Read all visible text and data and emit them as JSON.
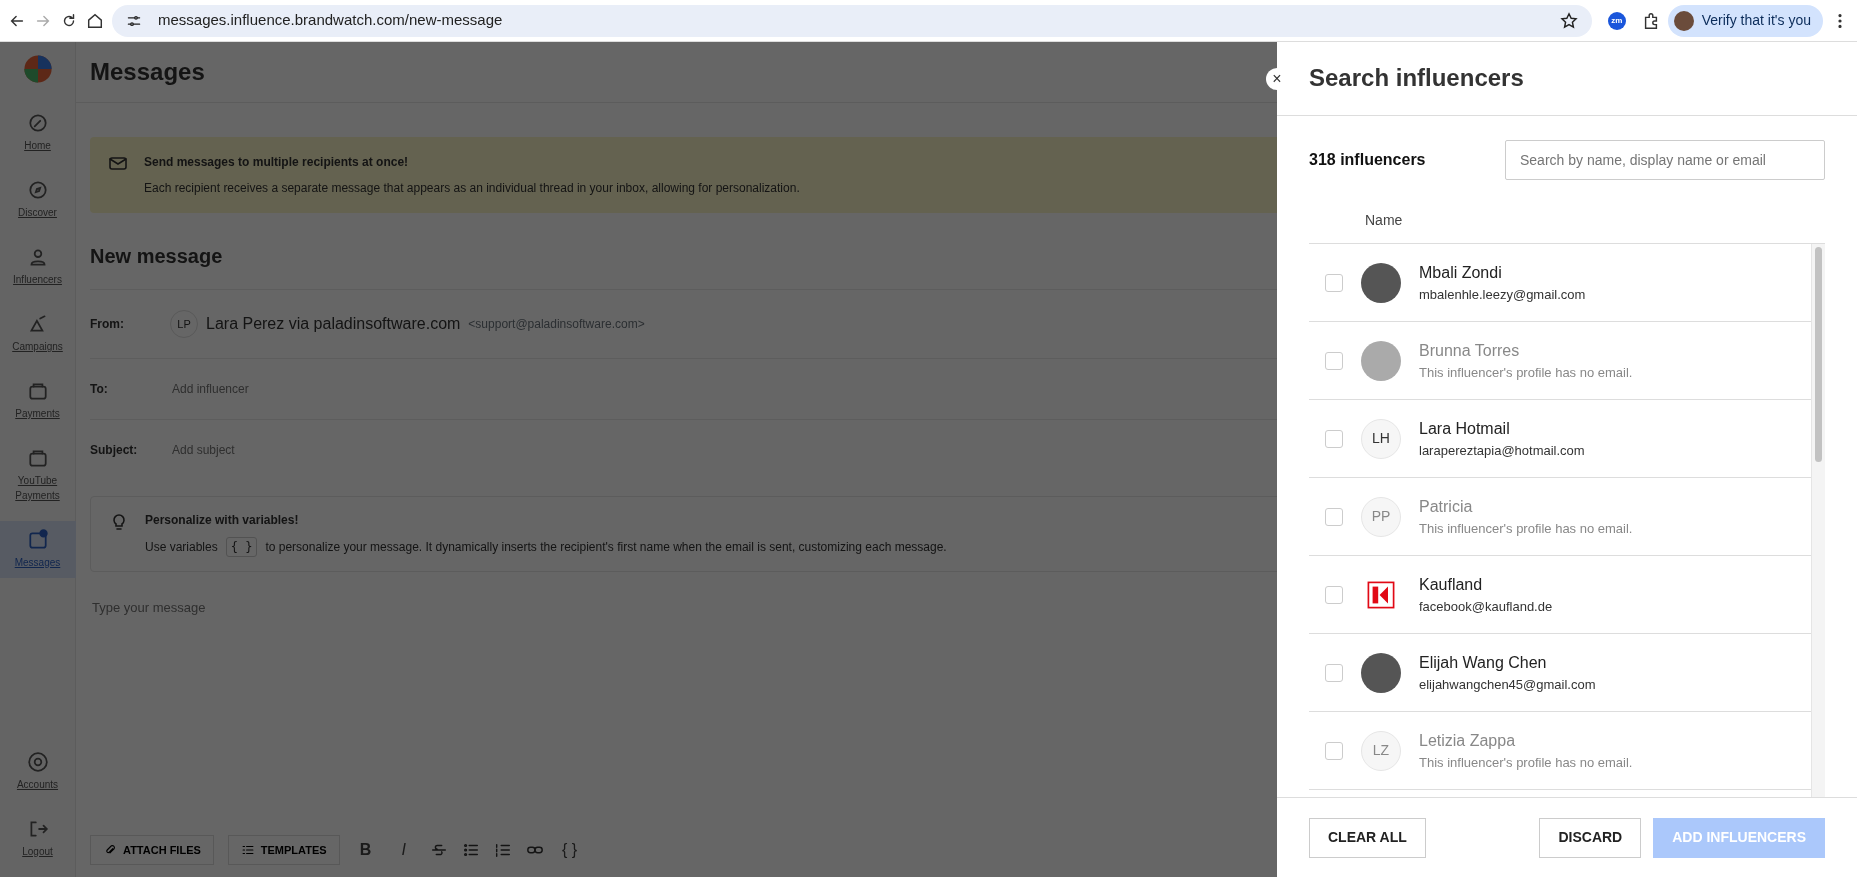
{
  "browser": {
    "url": "messages.influence.brandwatch.com/new-message",
    "extension_badge": "zm",
    "profile_label": "Verify that it's you"
  },
  "sidebar": {
    "items": [
      {
        "label": "Home",
        "kind": "home",
        "selected": false
      },
      {
        "label": "Discover",
        "kind": "discover",
        "selected": false
      },
      {
        "label": "Influencers",
        "kind": "person",
        "selected": false
      },
      {
        "label": "Campaigns",
        "kind": "campaign",
        "selected": false
      },
      {
        "label": "Payments",
        "kind": "wallet",
        "selected": false
      },
      {
        "label": "YouTube Payments",
        "kind": "wallet",
        "selected": false
      },
      {
        "label": "Messages",
        "kind": "message",
        "selected": true
      }
    ],
    "bottom_items": [
      {
        "label": "Accounts",
        "kind": "account"
      },
      {
        "label": "Logout",
        "kind": "logout"
      }
    ]
  },
  "page": {
    "title": "Messages",
    "banner": {
      "title": "Send messages to multiple recipients at once!",
      "text": "Each recipient receives a separate message that appears as an individual thread in your inbox, allowing for personalization."
    },
    "compose_title": "New message",
    "from": {
      "label": "From:",
      "initials": "LP",
      "name": "Lara Perez via paladinsoftware.com",
      "address": "<support@paladinsoftware.com>"
    },
    "to": {
      "label": "To:",
      "placeholder": "Add influencer"
    },
    "subject": {
      "label": "Subject:",
      "placeholder": "Add subject"
    },
    "tip": {
      "title": "Personalize with variables!",
      "text_before": "Use variables",
      "variable_chip": "{ }",
      "text_after": "to personalize your message. It dynamically inserts the recipient's first name when the email is sent, customizing each message."
    },
    "message": {
      "placeholder": "Type your message"
    },
    "toolbar": {
      "buttons": [
        {
          "label": "ATTACH FILES",
          "kind": "attach"
        },
        {
          "label": "TEMPLATES",
          "kind": "templates"
        }
      ],
      "format_tools": [
        {
          "kind": "bold",
          "glyph": "B"
        },
        {
          "kind": "italic",
          "glyph": "I"
        },
        {
          "kind": "strike"
        },
        {
          "kind": "bullets"
        },
        {
          "kind": "numbers"
        },
        {
          "kind": "link"
        },
        {
          "kind": "variable",
          "glyph": "{ }"
        }
      ]
    }
  },
  "panel": {
    "title": "Search influencers",
    "close": "×",
    "count": "318 influencers",
    "search": {
      "placeholder": "Search by name, display name or email"
    },
    "column": "Name",
    "rows": [
      {
        "name": "Mbali Zondi",
        "detail": "mbalenhle.leezy@gmail.com",
        "kind": "photo",
        "checked": false,
        "disabled": false
      },
      {
        "name": "Brunna Torres",
        "detail": "This influencer's profile has no email.",
        "kind": "photo",
        "checked": false,
        "disabled": true
      },
      {
        "name": "Lara Hotmail",
        "detail": "larapereztapia@hotmail.com",
        "kind": "initials",
        "initials": "LH",
        "checked": false,
        "disabled": false
      },
      {
        "name": "Patricia",
        "detail": "This influencer's profile has no email.",
        "kind": "initials",
        "initials": "PP",
        "checked": false,
        "disabled": true
      },
      {
        "name": "Kaufland",
        "detail": "facebook@kaufland.de",
        "kind": "logo",
        "checked": false,
        "disabled": false
      },
      {
        "name": "Elijah Wang Chen",
        "detail": "elijahwangchen45@gmail.com",
        "kind": "photo",
        "checked": false,
        "disabled": false
      },
      {
        "name": "Letizia Zappa",
        "detail": "This influencer's profile has no email.",
        "kind": "initials",
        "initials": "LZ",
        "checked": false,
        "disabled": true
      }
    ],
    "buttons": {
      "clear": "CLEAR ALL",
      "discard": "DISCARD",
      "add": {
        "label": "ADD INFLUENCERS",
        "disabled": true
      }
    }
  }
}
